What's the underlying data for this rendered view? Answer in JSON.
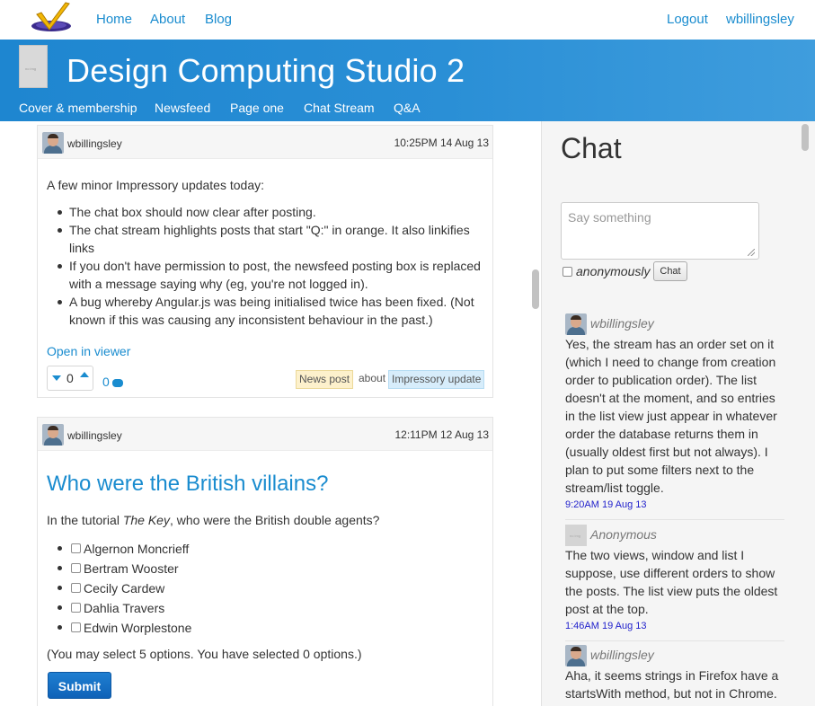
{
  "nav": {
    "home": "Home",
    "about": "About",
    "blog": "Blog",
    "logout": "Logout",
    "user": "wbillingsley"
  },
  "banner": {
    "title": "Design Computing Studio 2",
    "links": [
      "Cover & membership",
      "Newsfeed",
      "Page one",
      "Chat Stream",
      "Q&A"
    ]
  },
  "posts": [
    {
      "author": "wbillingsley",
      "time": "10:25PM 14 Aug 13",
      "intro": "A few minor Impressory updates today:",
      "bullets": [
        "The chat box should now clear after posting.",
        "The chat stream highlights posts that start \"Q:\" in orange. It also linkifies links",
        "If you don't have permission to post, the newsfeed posting box is replaced with a message saying why (eg, you're not logged in).",
        "A bug whereby Angular.js was being initialised twice has been fixed. (Not known if this was causing any inconsistent behaviour in the past.)"
      ],
      "open_link": "Open in viewer",
      "votes": "0",
      "comments": "0",
      "tag_type": "News post",
      "tag_about": "about",
      "tag_topic": "Impressory update"
    },
    {
      "author": "wbillingsley",
      "time": "12:11PM 12 Aug 13",
      "title": "Who were the British villains?",
      "prompt_pre": "In the tutorial ",
      "prompt_em": "The Key",
      "prompt_post": ", who were the British double agents?",
      "options": [
        "Algernon Moncrieff",
        "Bertram Wooster",
        "Cecily Cardew",
        "Dahlia Travers",
        "Edwin Worplestone"
      ],
      "note": "(You may select 5 options. You have selected 0 options.)",
      "submit": "Submit"
    }
  ],
  "chat": {
    "title": "Chat",
    "placeholder": "Say something",
    "anon_label": "anonymously",
    "button": "Chat",
    "messages": [
      {
        "author": "wbillingsley",
        "text": "Yes, the stream has an order set on it (which I need to change from creation order to publication order). The list doesn't at the moment, and so entries in the list view just appear in whatever order the database returns them in (usually oldest first but not always). I plan to put some filters next to the stream/list toggle.",
        "time": "9:20AM 19 Aug 13"
      },
      {
        "author": "Anonymous",
        "text": "The two views, window and list I suppose, use different orders to show the posts. The list view puts the oldest post at the top.",
        "time": "1:46AM 19 Aug 13"
      },
      {
        "author": "wbillingsley",
        "text": "Aha, it seems strings in Firefox have a startsWith method, but not in Chrome.",
        "time": ""
      }
    ]
  },
  "colors": {
    "accent": "#1a8ccf",
    "banner": "#2a8fd6",
    "tag_news": "#fdf1cc",
    "tag_topic": "#d7edfb",
    "timestamp": "#2222cc"
  }
}
